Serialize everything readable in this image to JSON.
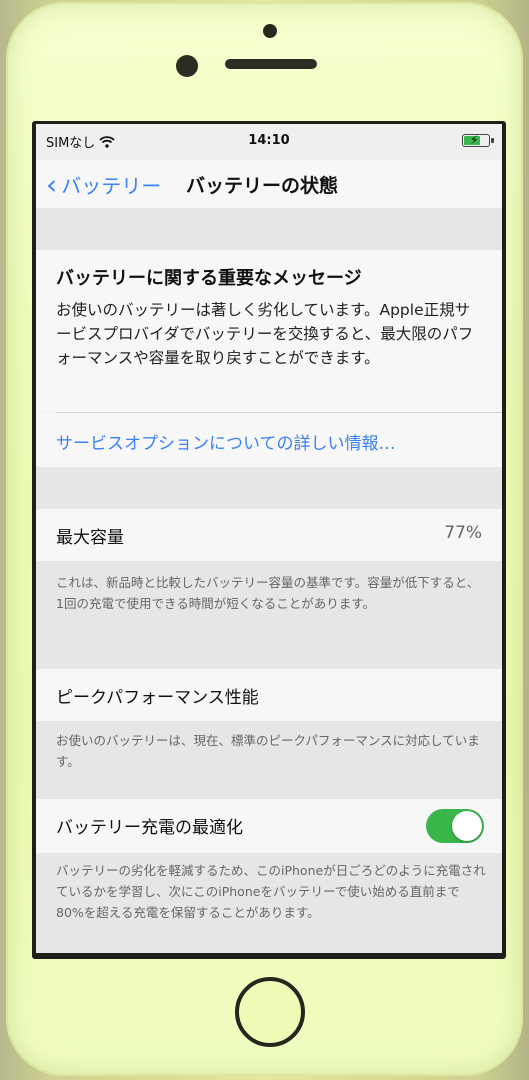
{
  "status_bar": {
    "carrier": "SIMなし",
    "time": "14:10",
    "battery_charging": true
  },
  "nav": {
    "back_label": "バッテリー",
    "title": "バッテリーの状態"
  },
  "message": {
    "title": "バッテリーに関する重要なメッセージ",
    "body": "お使いのバッテリーは著しく劣化しています。Apple正規サービスプロバイダでバッテリーを交換すると、最大限のパフォーマンスや容量を取り戻すことができます。",
    "link": "サービスオプションについての詳しい情報…"
  },
  "max_capacity": {
    "label": "最大容量",
    "value": "77%",
    "footer": "これは、新品時と比較したバッテリー容量の基準です。容量が低下すると、1回の充電で使用できる時間が短くなることがあります。"
  },
  "peak_performance": {
    "label": "ピークパフォーマンス性能",
    "footer": "お使いのバッテリーは、現在、標準のピークパフォーマンスに対応しています。"
  },
  "optimized_charging": {
    "label": "バッテリー充電の最適化",
    "enabled": true,
    "footer": "バッテリーの劣化を軽減するため、このiPhoneが日ごろどのように充電されているかを学習し、次にこのiPhoneをバッテリーで使い始める直前まで80%を超える充電を保留することがあります。"
  },
  "colors": {
    "accent": "#3a82f7",
    "toggle_on": "#3ab54a",
    "phone_body": "#ecfab2"
  }
}
